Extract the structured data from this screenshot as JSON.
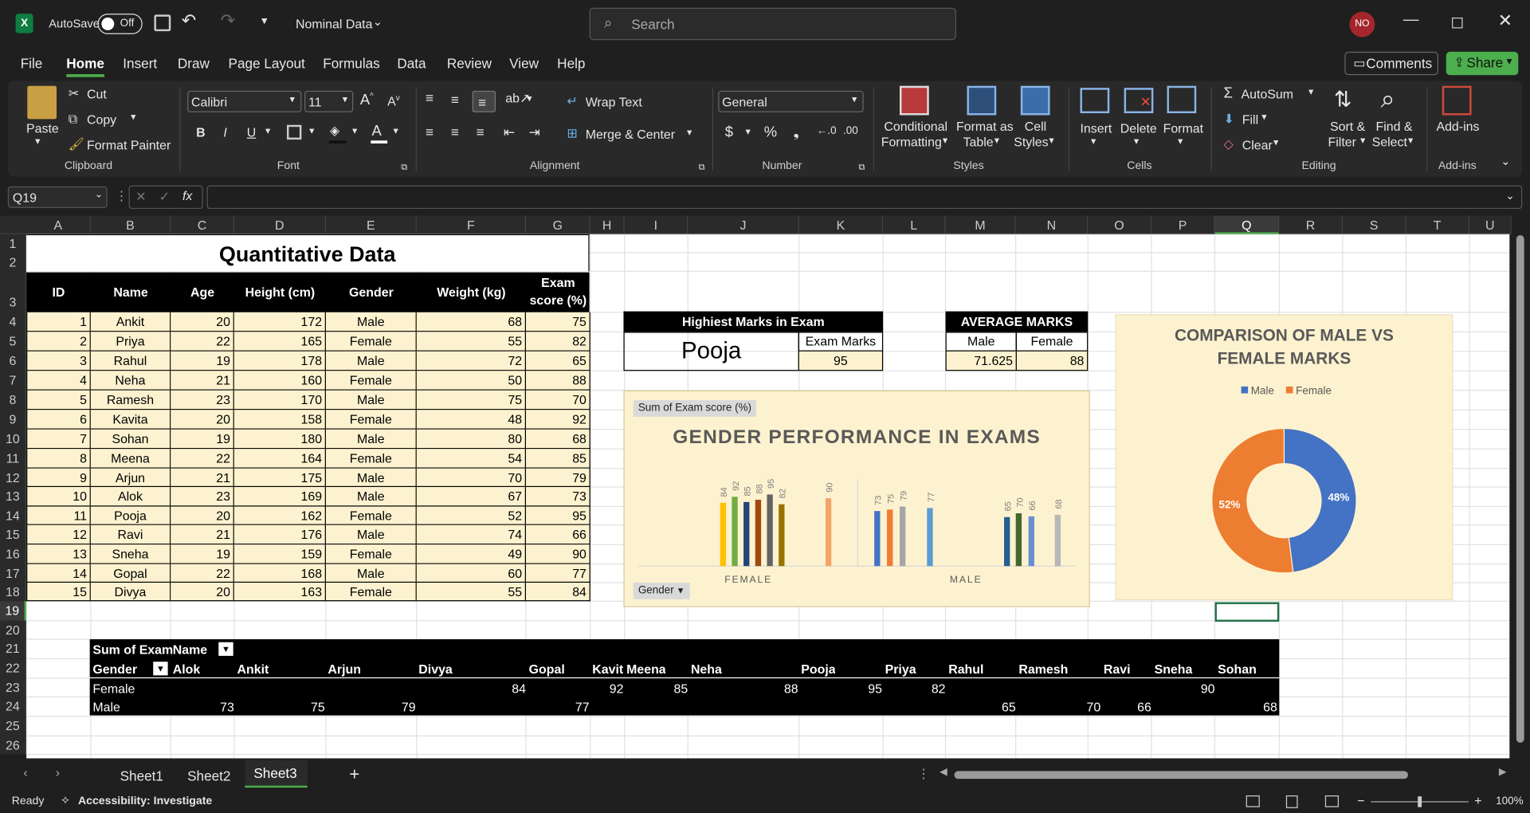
{
  "titlebar": {
    "autosave": "AutoSave",
    "toggle": "Off",
    "doc_name": "Nominal Data",
    "search_placeholder": "Search",
    "avatar": "NO"
  },
  "menu": [
    "File",
    "Home",
    "Insert",
    "Draw",
    "Page Layout",
    "Formulas",
    "Data",
    "Review",
    "View",
    "Help"
  ],
  "comments": "Comments",
  "share": "Share",
  "ribbon": {
    "paste": "Paste",
    "cut": "Cut",
    "copy": "Copy",
    "format_painter": "Format Painter",
    "font": "Calibri",
    "font_size": "11",
    "bold": "B",
    "italic": "I",
    "underline": "U",
    "wrap_text": "Wrap Text",
    "merge_center": "Merge & Center",
    "number_format": "General",
    "conditional": "Conditional",
    "formatting": "Formatting",
    "format_as": "Format as",
    "table": "Table",
    "cell": "Cell",
    "styles": "Styles",
    "insert": "Insert",
    "delete": "Delete",
    "format": "Format",
    "autosum": "AutoSum",
    "fill": "Fill",
    "clear": "Clear",
    "sort": "Sort &",
    "filter": "Filter",
    "find": "Find &",
    "select": "Select",
    "addins": "Add-ins",
    "groups": {
      "clipboard": "Clipboard",
      "font": "Font",
      "alignment": "Alignment",
      "number": "Number",
      "styles": "Styles",
      "cells": "Cells",
      "editing": "Editing",
      "addins": "Add-ins"
    }
  },
  "namebox": "Q19",
  "columns": [
    "A",
    "B",
    "C",
    "D",
    "E",
    "F",
    "G",
    "H",
    "I",
    "J",
    "K",
    "L",
    "M",
    "N",
    "O",
    "P",
    "Q",
    "R",
    "S",
    "T",
    "U"
  ],
  "rows": [
    "1",
    "2",
    "3",
    "4",
    "5",
    "6",
    "7",
    "8",
    "9",
    "10",
    "11",
    "12",
    "13",
    "14",
    "15",
    "16",
    "17",
    "18",
    "19",
    "20",
    "21",
    "22",
    "23",
    "24",
    "25",
    "26"
  ],
  "table": {
    "title": "Quantitative Data",
    "headers": [
      "ID",
      "Name",
      "Age",
      "Height (cm)",
      "Gender",
      "Weight (kg)",
      "Exam score (%)"
    ],
    "header_g1": "Exam",
    "header_g2": "score (%)",
    "rows": [
      [
        "1",
        "Ankit",
        "20",
        "172",
        "Male",
        "68",
        "75"
      ],
      [
        "2",
        "Priya",
        "22",
        "165",
        "Female",
        "55",
        "82"
      ],
      [
        "3",
        "Rahul",
        "19",
        "178",
        "Male",
        "72",
        "65"
      ],
      [
        "4",
        "Neha",
        "21",
        "160",
        "Female",
        "50",
        "88"
      ],
      [
        "5",
        "Ramesh",
        "23",
        "170",
        "Male",
        "75",
        "70"
      ],
      [
        "6",
        "Kavita",
        "20",
        "158",
        "Female",
        "48",
        "92"
      ],
      [
        "7",
        "Sohan",
        "19",
        "180",
        "Male",
        "80",
        "68"
      ],
      [
        "8",
        "Meena",
        "22",
        "164",
        "Female",
        "54",
        "85"
      ],
      [
        "9",
        "Arjun",
        "21",
        "175",
        "Male",
        "70",
        "79"
      ],
      [
        "10",
        "Alok",
        "23",
        "169",
        "Male",
        "67",
        "73"
      ],
      [
        "11",
        "Pooja",
        "20",
        "162",
        "Female",
        "52",
        "95"
      ],
      [
        "12",
        "Ravi",
        "21",
        "176",
        "Male",
        "74",
        "66"
      ],
      [
        "13",
        "Sneha",
        "19",
        "159",
        "Female",
        "49",
        "90"
      ],
      [
        "14",
        "Gopal",
        "22",
        "168",
        "Male",
        "60",
        "77"
      ],
      [
        "15",
        "Divya",
        "20",
        "163",
        "Female",
        "55",
        "84"
      ]
    ]
  },
  "highest": {
    "title": "Highiest Marks in Exam",
    "name": "Pooja",
    "label": "Exam Marks",
    "value": "95"
  },
  "average": {
    "title": "AVERAGE MARKS",
    "male_label": "Male",
    "female_label": "Female",
    "male": "71.625",
    "female": "88"
  },
  "pivot": {
    "corner": "Sum of Exam",
    "name_hdr": "Name",
    "gender_hdr": "Gender",
    "names": [
      "Alok",
      "Ankit",
      "Arjun",
      "Divya",
      "Gopal",
      "Kavit",
      "Meena",
      "Neha",
      "Pooja",
      "Priya",
      "Rahul",
      "Ramesh",
      "Ravi",
      "Sneha",
      "Sohan"
    ],
    "female_label": "Female",
    "male_label": "Male",
    "female": [
      "",
      "",
      "",
      "84",
      "",
      "92",
      "85",
      "88",
      "95",
      "82",
      "",
      "",
      "",
      "90",
      ""
    ],
    "male": [
      "73",
      "75",
      "79",
      "",
      "77",
      "",
      "",
      "",
      "",
      "",
      "65",
      "70",
      "66",
      "",
      "68"
    ]
  },
  "chart_data": [
    {
      "type": "bar",
      "title": "GENDER PERFORMANCE IN EXAMS",
      "field_button": "Sum of Exam score (%)",
      "filter_button": "Gender",
      "categories": [
        "FEMALE",
        "MALE"
      ],
      "series": [
        {
          "name": "Divya",
          "values": [
            84,
            null
          ],
          "color": "#ffc000"
        },
        {
          "name": "Kavita",
          "values": [
            92,
            null
          ],
          "color": "#70ad47"
        },
        {
          "name": "Meena",
          "values": [
            85,
            null
          ],
          "color": "#264478"
        },
        {
          "name": "Neha",
          "values": [
            88,
            null
          ],
          "color": "#9e480e"
        },
        {
          "name": "Pooja",
          "values": [
            95,
            null
          ],
          "color": "#636363"
        },
        {
          "name": "Priya",
          "values": [
            82,
            null
          ],
          "color": "#997300"
        },
        {
          "name": "Sneha",
          "values": [
            90,
            null
          ],
          "color": "#f4a46a"
        },
        {
          "name": "Alok",
          "values": [
            null,
            73
          ],
          "color": "#4472c4"
        },
        {
          "name": "Ankit",
          "values": [
            null,
            75
          ],
          "color": "#ed7d31"
        },
        {
          "name": "Arjun",
          "values": [
            null,
            79
          ],
          "color": "#a5a5a5"
        },
        {
          "name": "Gopal",
          "values": [
            null,
            77
          ],
          "color": "#5b9bd5"
        },
        {
          "name": "Rahul",
          "values": [
            null,
            65
          ],
          "color": "#255e91"
        },
        {
          "name": "Ramesh",
          "values": [
            null,
            70
          ],
          "color": "#43682b"
        },
        {
          "name": "Ravi",
          "values": [
            null,
            66
          ],
          "color": "#698ed0"
        },
        {
          "name": "Sohan",
          "values": [
            null,
            68
          ],
          "color": "#b7b7b7"
        }
      ]
    },
    {
      "type": "pie",
      "title": "COMPARISON OF MALE VS FEMALE MARKS",
      "title_l1": "COMPARISON OF MALE VS",
      "title_l2": "FEMALE MARKS",
      "legend": [
        "Male",
        "Female"
      ],
      "slices": [
        {
          "name": "Male",
          "value": 48,
          "label": "48%",
          "color": "#4472c4"
        },
        {
          "name": "Female",
          "value": 52,
          "label": "52%",
          "color": "#ed7d31"
        }
      ]
    }
  ],
  "sheets": [
    "Sheet1",
    "Sheet2",
    "Sheet3"
  ],
  "status": {
    "ready": "Ready",
    "accessibility": "Accessibility: Investigate",
    "zoom": "100%"
  }
}
